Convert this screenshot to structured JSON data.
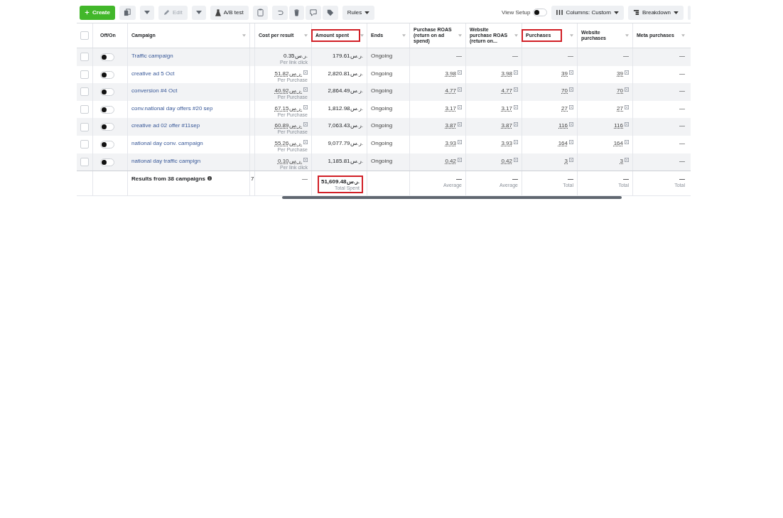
{
  "toolbar": {
    "create": "Create",
    "edit": {
      "label": "Edit",
      "disabled": true
    },
    "ab_test": "A/B test",
    "rules": "Rules",
    "view_setup": {
      "label": "View Setup",
      "on": false
    },
    "columns": "Columns: Custom",
    "breakdown": "Breakdown"
  },
  "table": {
    "select_all_checked": false,
    "columns": [
      {
        "label": "Off/On",
        "highlighted": false
      },
      {
        "label": "Campaign",
        "highlighted": false
      },
      {
        "label": "Cost per result",
        "highlighted": false
      },
      {
        "label": "Amount spent",
        "highlighted": true
      },
      {
        "label": "Ends",
        "highlighted": false
      },
      {
        "label": "Purchase ROAS (return on ad spend)",
        "highlighted": false
      },
      {
        "label": "Website purchase ROAS (return on...",
        "highlighted": false
      },
      {
        "label": "Purchases",
        "highlighted": true
      },
      {
        "label": "Website purchases",
        "highlighted": false
      },
      {
        "label": "Meta purchases",
        "highlighted": false
      }
    ],
    "rows": [
      {
        "name": "Traffic campaign",
        "checked": false,
        "on": false,
        "has_details": false,
        "cost": "0.35ر.س.",
        "cost_basis": "Per link click",
        "spent": "179.61ر.س.",
        "ends": "Ongoing",
        "metrics": [
          "—",
          "—",
          "—",
          "—",
          "—"
        ]
      },
      {
        "name": "creative ad 5 Oct",
        "checked": false,
        "on": false,
        "has_details": true,
        "cost": "51.82ر.س.",
        "cost_basis": "Per Purchase",
        "spent": "2,820.81ر.س.",
        "ends": "Ongoing",
        "metrics": [
          "3.98",
          "3.98",
          "39",
          "39",
          "—"
        ]
      },
      {
        "name": "conversion #4 Oct",
        "checked": false,
        "on": false,
        "has_details": true,
        "cost": "40.92ر.س.",
        "cost_basis": "Per Purchase",
        "spent": "2,864.49ر.س.",
        "ends": "Ongoing",
        "metrics": [
          "4.77",
          "4.77",
          "70",
          "70",
          "—"
        ]
      },
      {
        "name": "conv.national day offers #20 sep",
        "checked": false,
        "on": false,
        "has_details": true,
        "cost": "67.15ر.س.",
        "cost_basis": "Per Purchase",
        "spent": "1,812.98ر.س.",
        "ends": "Ongoing",
        "metrics": [
          "3.17",
          "3.17",
          "27",
          "27",
          "—"
        ]
      },
      {
        "name": "creative ad 02 offer #11sep",
        "checked": false,
        "on": false,
        "has_details": true,
        "cost": "60.89ر.س.",
        "cost_basis": "Per Purchase",
        "spent": "7,063.43ر.س.",
        "ends": "Ongoing",
        "metrics": [
          "3.87",
          "3.87",
          "116",
          "116",
          "—"
        ]
      },
      {
        "name": "national day conv. campaign",
        "checked": false,
        "on": false,
        "has_details": true,
        "cost": "55.26ر.س.",
        "cost_basis": "Per Purchase",
        "spent": "9,077.79ر.س.",
        "ends": "Ongoing",
        "metrics": [
          "3.93",
          "3.93",
          "164",
          "164",
          "—"
        ]
      },
      {
        "name": "national day traffic campign",
        "checked": false,
        "on": false,
        "has_details": true,
        "cost": "0.10ر.س.",
        "cost_basis": "Per link click",
        "spent": "1,185.81ر.س.",
        "ends": "Ongoing",
        "metrics": [
          "0.42",
          "0.42",
          "3",
          "3",
          "—"
        ]
      }
    ],
    "footer": {
      "label": "Results from 38 campaigns",
      "column_3": "7",
      "cost": "—",
      "spent": {
        "value": "51,609.48ر.س.",
        "note": "Total Spent",
        "highlighted": true
      },
      "metrics": [
        {
          "value": "—",
          "note": "Average"
        },
        {
          "value": "—",
          "note": "Average"
        },
        {
          "value": "—",
          "note": "Total"
        },
        {
          "value": "—",
          "note": "Total"
        },
        {
          "value": "—",
          "note": "Total"
        }
      ]
    }
  }
}
